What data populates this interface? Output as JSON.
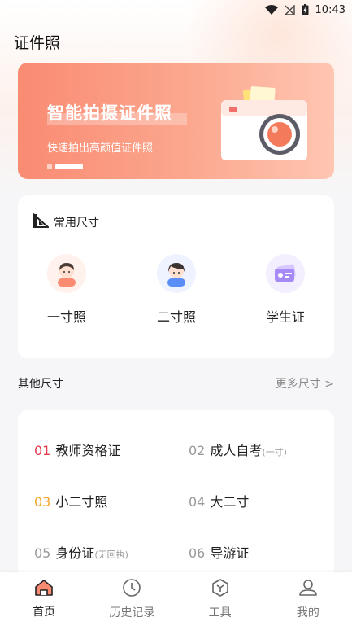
{
  "status_bar": {
    "time": "10:43"
  },
  "header": {
    "title": "证件照"
  },
  "banner": {
    "title": "智能拍摄证件照",
    "subtitle": "快速拍出高颜值证件照"
  },
  "common_sizes": {
    "title": "常用尺寸",
    "items": [
      {
        "label": "一寸照",
        "icon": "girl-avatar-icon"
      },
      {
        "label": "二寸照",
        "icon": "boy-avatar-icon"
      },
      {
        "label": "学生证",
        "icon": "student-card-icon"
      }
    ]
  },
  "other_sizes": {
    "title": "其他尺寸",
    "more": "更多尺寸 >",
    "items": [
      {
        "num": "01",
        "label": "教师资格证",
        "note": ""
      },
      {
        "num": "02",
        "label": "成人自考",
        "note": "(一寸)"
      },
      {
        "num": "03",
        "label": "小二寸照",
        "note": ""
      },
      {
        "num": "04",
        "label": "大二寸",
        "note": ""
      },
      {
        "num": "05",
        "label": "身份证",
        "note": "(无回执)"
      },
      {
        "num": "06",
        "label": "导游证",
        "note": ""
      }
    ]
  },
  "tabs": [
    {
      "label": "首页",
      "icon": "home-icon",
      "active": true
    },
    {
      "label": "历史记录",
      "icon": "clock-icon",
      "active": false
    },
    {
      "label": "工具",
      "icon": "cube-icon",
      "active": false
    },
    {
      "label": "我的",
      "icon": "user-icon",
      "active": false
    }
  ],
  "colors": {
    "accent": "#f98b72",
    "num_red": "#e4394c",
    "num_orange": "#f3a72d"
  }
}
